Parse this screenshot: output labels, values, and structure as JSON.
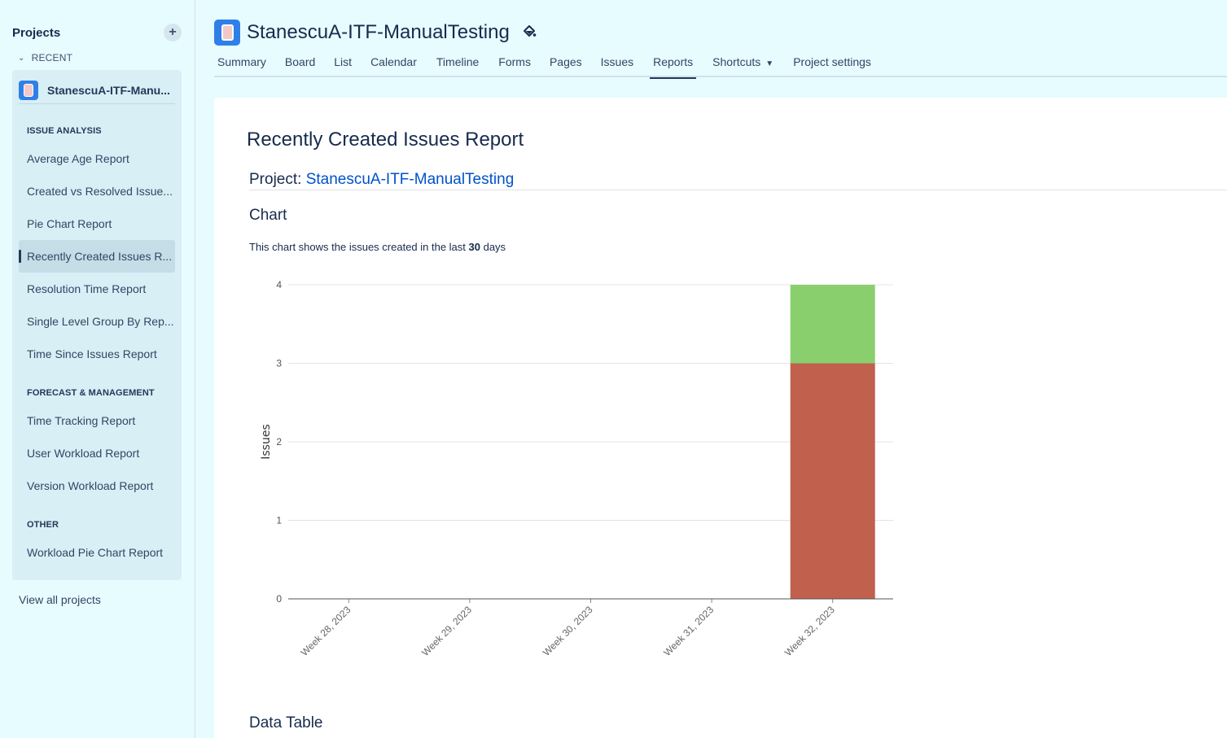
{
  "sidebar": {
    "title": "Projects",
    "add_label": "+",
    "recent_label": "RECENT",
    "project_name": "StanescuA-ITF-Manu...",
    "sections": [
      {
        "label": "ISSUE ANALYSIS"
      },
      {
        "label": "FORECAST & MANAGEMENT"
      },
      {
        "label": "OTHER"
      }
    ],
    "items": [
      {
        "label": "Average Age Report"
      },
      {
        "label": "Created vs Resolved Issue..."
      },
      {
        "label": "Pie Chart Report"
      },
      {
        "label": "Recently Created Issues R..."
      },
      {
        "label": "Resolution Time Report"
      },
      {
        "label": "Single Level Group By Rep..."
      },
      {
        "label": "Time Since Issues Report"
      },
      {
        "label": "Time Tracking Report"
      },
      {
        "label": "User Workload Report"
      },
      {
        "label": "Version Workload Report"
      },
      {
        "label": "Workload Pie Chart Report"
      }
    ],
    "view_all": "View all projects"
  },
  "header": {
    "title": "StanescuA-ITF-ManualTesting",
    "tabs": [
      {
        "label": "Summary"
      },
      {
        "label": "Board"
      },
      {
        "label": "List"
      },
      {
        "label": "Calendar"
      },
      {
        "label": "Timeline"
      },
      {
        "label": "Forms"
      },
      {
        "label": "Pages"
      },
      {
        "label": "Issues"
      },
      {
        "label": "Reports"
      },
      {
        "label": "Shortcuts"
      },
      {
        "label": "Project settings"
      }
    ],
    "active_tab": "Reports"
  },
  "report": {
    "title": "Recently Created Issues Report",
    "project_prefix": "Project:",
    "project_link": "StanescuA-ITF-ManualTesting",
    "chart_heading": "Chart",
    "desc_before": "This chart shows the issues created in the last ",
    "desc_days": "30",
    "desc_after": " days",
    "data_table_heading": "Data Table"
  },
  "colors": {
    "accent": "#0052cc",
    "bar_bottom": "#c1604d",
    "bar_top": "#89cf6d"
  },
  "chart_data": {
    "type": "bar",
    "stacked": true,
    "categories": [
      "Week 28, 2023",
      "Week 29, 2023",
      "Week 30, 2023",
      "Week 31, 2023",
      "Week 32, 2023"
    ],
    "series": [
      {
        "color": "#c1604d",
        "values": [
          0,
          0,
          0,
          0,
          3
        ]
      },
      {
        "color": "#89cf6d",
        "values": [
          0,
          0,
          0,
          0,
          1
        ]
      }
    ],
    "ylabel": "Issues",
    "ylim": [
      0,
      4
    ],
    "yticks": [
      0,
      1,
      2,
      3,
      4
    ],
    "grid": true
  }
}
